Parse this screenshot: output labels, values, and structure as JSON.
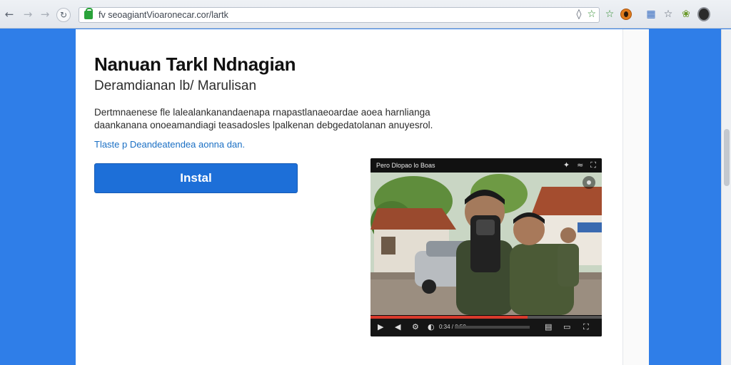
{
  "browser": {
    "url": "fv seoagiantVioaronecar.cor/lartk",
    "back_icon": "arrow-left-icon",
    "forward_icon": "arrow-right-icon",
    "reload_icon": "reload-icon"
  },
  "page": {
    "title": "Nanuan Tarkl Ndnagian",
    "subtitle": "Deramdianan lb/ Marulisan",
    "description_line1": "Dertmnaenese fle lalealankanandaenapa rnapastlanaeoardae aoea harnlianga",
    "description_line2": "daankanana onoeamandiagi teasadosles lpalkenan debgedatolanan anuyesrol.",
    "link": "Tlaste p Deandeatendea aonna dan.",
    "install_label": "Instal"
  },
  "video": {
    "title": "Pero Dlopao lo Boas",
    "progress_fraction": 0.68,
    "time": "0:34 / 0:50"
  },
  "colors": {
    "accent": "#1d6fd8",
    "link": "#1a6fc4",
    "background": "#2f7ee8",
    "progress": "#d93a2c"
  }
}
